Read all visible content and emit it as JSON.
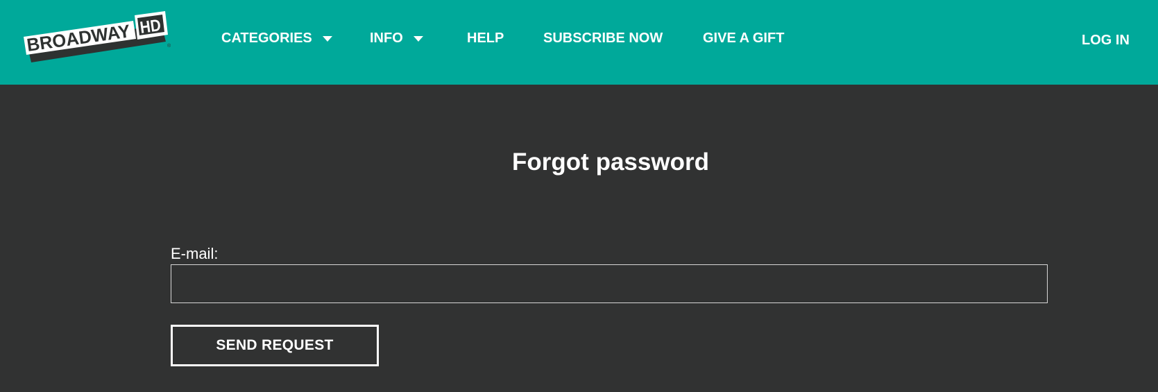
{
  "header": {
    "logo": {
      "icon": "broadwayhd-logo",
      "text_main": "BROADWAY",
      "text_badge": "HD",
      "trademark": "®"
    },
    "nav": {
      "categories": "CATEGORIES",
      "info": "INFO",
      "help": "HELP",
      "subscribe": "SUBSCRIBE NOW",
      "gift": "GIVE A GIFT"
    },
    "login": "LOG IN"
  },
  "main": {
    "title": "Forgot password",
    "email_label": "E-mail:",
    "email_value": "",
    "email_placeholder": "",
    "send_button": "SEND REQUEST"
  },
  "colors": {
    "header_bg": "#00a99a",
    "page_bg": "#313232",
    "text": "#ffffff",
    "logo_dark": "#2e3231"
  }
}
